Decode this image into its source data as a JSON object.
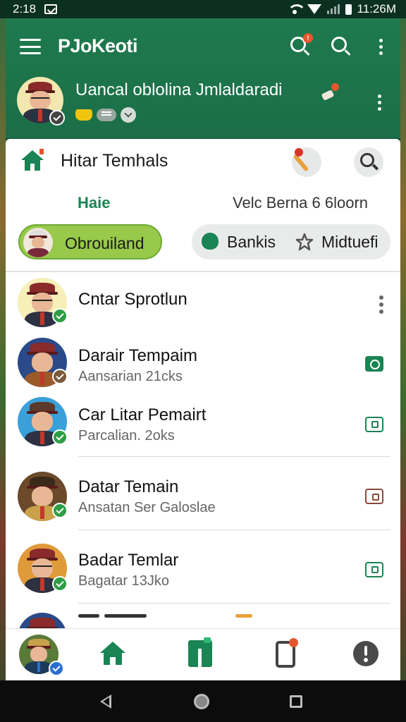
{
  "statusbar": {
    "time": "2:18",
    "clock": "11:26M"
  },
  "appbar": {
    "title": "PJoKeoti",
    "notif_badge": "!",
    "profile_name": "Uancal oblolina Jmlaldaradi"
  },
  "card": {
    "title": "Hitar Temhals",
    "tabs": [
      {
        "label": "Haie"
      },
      {
        "label": "Velc Berna 6 6loorn"
      }
    ],
    "filters": {
      "active": "Obrouiland",
      "segments": [
        {
          "label": "Bankis"
        },
        {
          "label": "Midtuefi"
        }
      ]
    }
  },
  "list": [
    {
      "name": "Cntar Sprotlun",
      "sub": ""
    },
    {
      "name": "Darair Tempaim",
      "sub": "Aansarian 21cks"
    },
    {
      "name": "Car Litar Pemairt",
      "sub": "Parcalian. 2oks"
    },
    {
      "name": "Datar Temain",
      "sub": "Ansatan Ser Galoslae"
    },
    {
      "name": "Badar Temlar",
      "sub": "Bagatar 13Jko"
    }
  ],
  "colors": {
    "brand": "#1a8454",
    "appbar": "#1e7a4e",
    "accent_pill": "#98c94a",
    "badge": "#e4572e"
  }
}
